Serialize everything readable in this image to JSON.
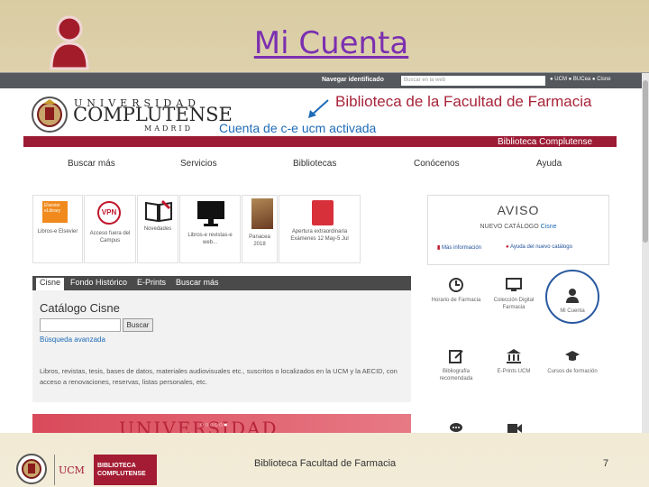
{
  "slide": {
    "title": "Mi Cuenta",
    "footer_text": "Biblioteca Facultad de Farmacia",
    "page_number": "7"
  },
  "site": {
    "nav_id": "Navegar identificado",
    "search_placeholder": "Buscar en la web",
    "top_links": "● UCM ● BUCea ● Cisne",
    "ucm_line1": "UNIVERSIDAD",
    "ucm_line2": "COMPLUTENSE",
    "ucm_line3": "MADRID",
    "library_title": "Biblioteca de la Facultad de Farmacia",
    "account_note": "Cuenta de c-e ucm activada",
    "red_bar_label": "Biblioteca Complutense",
    "menu": [
      "Buscar más",
      "Servicios",
      "Bibliotecas",
      "Conócenos",
      "Ayuda"
    ]
  },
  "tiles": [
    {
      "icon_text": "Elsevier eLibrary",
      "caption": "Libros-e Elsevier"
    },
    {
      "icon_text": "VPN",
      "caption": "Acceso fuera del Campus"
    },
    {
      "icon_text": "",
      "caption": "Novedades"
    },
    {
      "icon_text": "",
      "caption": "Libros-e revistas-e web..."
    },
    {
      "icon_text": "",
      "caption": "Panacea 2018"
    },
    {
      "icon_text": "",
      "caption": "Apertura extraordinaria Exámenes 12 May-5 Jul"
    }
  ],
  "aviso": {
    "title": "AVISO",
    "subtitle_prefix": "NUEVO CATÁLOGO",
    "subtitle_brand": "Cisne",
    "link_more": "Más información",
    "link_help": "Ayuda del nuevo catálogo"
  },
  "catalog": {
    "tabs": [
      "Cisne",
      "Fondo Histórico",
      "E-Prints",
      "Buscar más"
    ],
    "title": "Catálogo Cisne",
    "search_button": "Buscar",
    "advanced_link": "Búsqueda avanzada",
    "description": "Libros, revistas, tesis, bases de datos, materiales audiovisuales etc., suscritos o localizados en la UCM y la AECID, con acceso a renovaciones, reservas, listas personales, etc."
  },
  "banner": {
    "text": "UNIVERSIDAD COMPLUTENSE",
    "dots": "○○○○○●"
  },
  "quick_links": [
    {
      "label": "Horario de Farmacia",
      "icon": "clock-icon"
    },
    {
      "label": "Colección Digital Farmacia",
      "icon": "monitor-icon"
    },
    {
      "label": "Mi Cuenta",
      "icon": "user-icon"
    },
    {
      "label": "Bibliografía recomendada",
      "icon": "edit-icon"
    },
    {
      "label": "E-Prints UCM",
      "icon": "institution-icon"
    },
    {
      "label": "Cursos de formación",
      "icon": "graduation-cap-icon"
    }
  ],
  "footer_logo": {
    "line1": "BIBLIOTECA",
    "line2": "COMPLUTENSE",
    "mark": "UCM"
  },
  "colors": {
    "title_purple": "#7b2fb0",
    "ucm_red": "#9c1b35",
    "link_blue": "#1d6bb8"
  }
}
